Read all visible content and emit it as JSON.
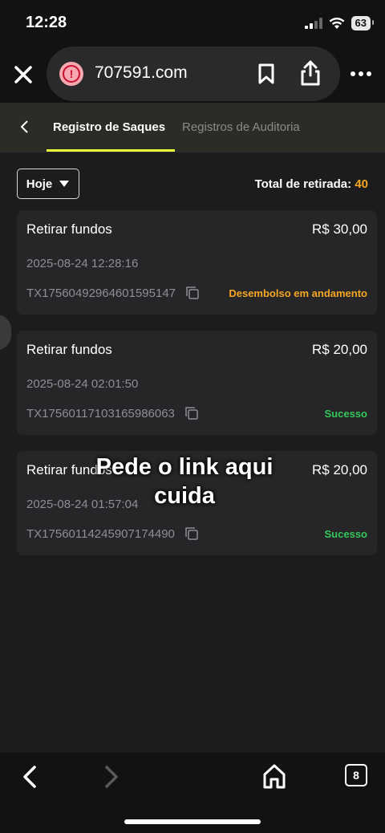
{
  "status_bar": {
    "time": "12:28",
    "battery": "63"
  },
  "browser": {
    "url": "707591.com",
    "tab_count": "8",
    "icons": [
      "close-icon",
      "warning-icon",
      "bookmark-icon",
      "share-icon",
      "more-icon",
      "back-icon",
      "forward-icon",
      "home-icon",
      "tabs-icon"
    ]
  },
  "tabs": {
    "active_label": "Registro de Saques",
    "inactive_label": "Registros de Auditoria"
  },
  "filter": {
    "label": "Hoje"
  },
  "total": {
    "label": "Total de retirada: ",
    "value": "40"
  },
  "records": [
    {
      "title": "Retirar fundos",
      "amount": "R$ 30,00",
      "date": "2025-08-24 12:28:16",
      "tx": "TX17560492964601595147",
      "status": "Desembolso em andamento"
    },
    {
      "title": "Retirar fundos",
      "amount": "R$ 20,00",
      "date": "2025-08-24 02:01:50",
      "tx": "TX17560117103165986063",
      "status": "Sucesso"
    },
    {
      "title": "Retirar fundos",
      "amount": "R$ 20,00",
      "date": "2025-08-24 01:57:04",
      "tx": "TX17560114245907174490",
      "status": "Sucesso"
    }
  ],
  "overlay_text": "Pede o link aqui cuida",
  "colors": {
    "accent_underline": "#e6ff3a",
    "pending": "#f5a623",
    "success": "#34c759"
  }
}
